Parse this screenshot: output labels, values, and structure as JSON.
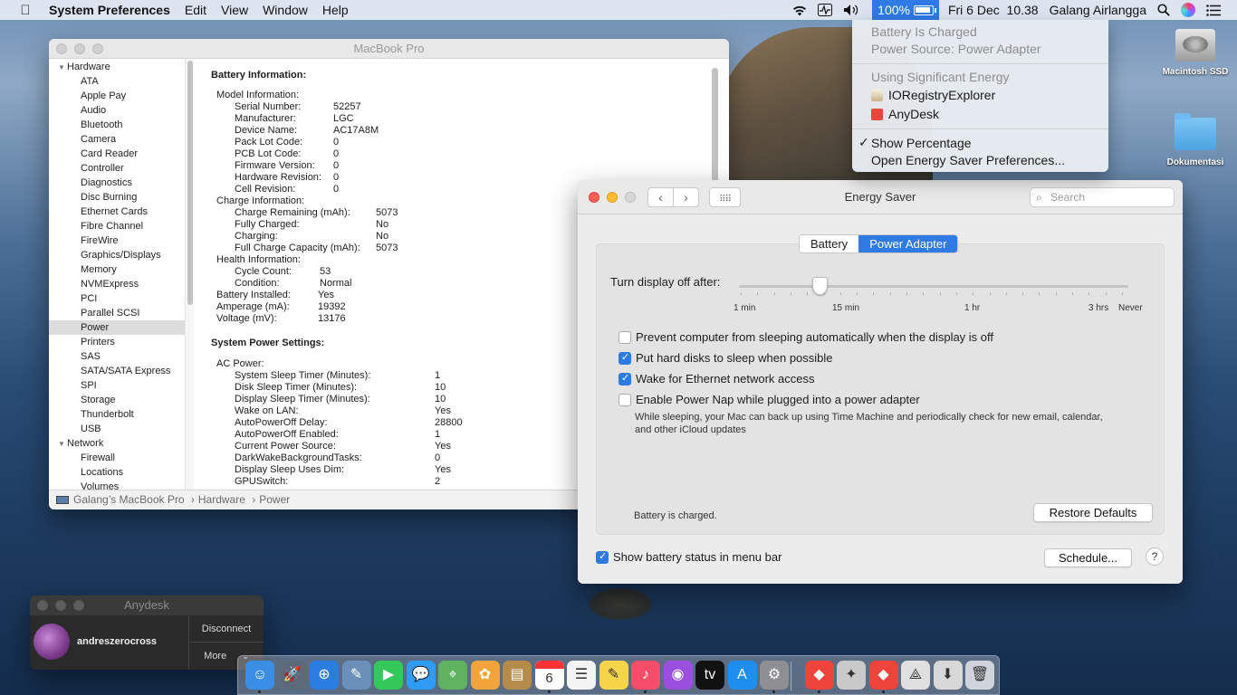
{
  "menubar": {
    "app_name": "System Preferences",
    "menus": [
      "Edit",
      "View",
      "Window",
      "Help"
    ],
    "battery_percent": "100%",
    "datetime": "Fri 6 Dec  10.38",
    "user": "Galang Airlangga"
  },
  "battery_menu": {
    "status": "Battery Is Charged",
    "source": "Power Source: Power Adapter",
    "energy_header": "Using Significant Energy",
    "apps": [
      "IORegistryExplorer",
      "AnyDesk"
    ],
    "show_percentage": "Show Percentage",
    "open_prefs": "Open Energy Saver Preferences..."
  },
  "desktop": {
    "drive_label": "Macintosh SSD",
    "folder_label": "Dokumentasi"
  },
  "sysinfo": {
    "title": "MacBook Pro",
    "sidebar": {
      "hardware_label": "Hardware",
      "hardware_items": [
        "ATA",
        "Apple Pay",
        "Audio",
        "Bluetooth",
        "Camera",
        "Card Reader",
        "Controller",
        "Diagnostics",
        "Disc Burning",
        "Ethernet Cards",
        "Fibre Channel",
        "FireWire",
        "Graphics/Displays",
        "Memory",
        "NVMExpress",
        "PCI",
        "Parallel SCSI",
        "Power",
        "Printers",
        "SAS",
        "SATA/SATA Express",
        "SPI",
        "Storage",
        "Thunderbolt",
        "USB"
      ],
      "selected": "Power",
      "network_label": "Network",
      "network_items": [
        "Firewall",
        "Locations",
        "Volumes"
      ]
    },
    "battery_heading": "Battery Information:",
    "battery_rows": [
      {
        "k": "Model Information:",
        "v": "",
        "indent": 0
      },
      {
        "k": "Serial Number:",
        "v": "52257",
        "indent": 1
      },
      {
        "k": "Manufacturer:",
        "v": "LGC",
        "indent": 1
      },
      {
        "k": "Device Name:",
        "v": "AC17A8M",
        "indent": 1
      },
      {
        "k": "Pack Lot Code:",
        "v": "0",
        "indent": 1
      },
      {
        "k": "PCB Lot Code:",
        "v": "0",
        "indent": 1
      },
      {
        "k": "Firmware Version:",
        "v": "0",
        "indent": 1
      },
      {
        "k": "Hardware Revision:",
        "v": "0",
        "indent": 1
      },
      {
        "k": "Cell Revision:",
        "v": "0",
        "indent": 1
      },
      {
        "k": "Charge Information:",
        "v": "",
        "indent": 0
      },
      {
        "k": "Charge Remaining (mAh):",
        "v": "5073",
        "indent": 2
      },
      {
        "k": "Fully Charged:",
        "v": "No",
        "indent": 2
      },
      {
        "k": "Charging:",
        "v": "No",
        "indent": 2
      },
      {
        "k": "Full Charge Capacity (mAh):",
        "v": "5073",
        "indent": 2
      },
      {
        "k": "Health Information:",
        "v": "",
        "indent": 0
      },
      {
        "k": "Cycle Count:",
        "v": "53",
        "indent": 3
      },
      {
        "k": "Condition:",
        "v": "Normal",
        "indent": 3
      },
      {
        "k": "Battery Installed:",
        "v": "Yes",
        "indent": 4
      },
      {
        "k": "Amperage (mA):",
        "v": "19392",
        "indent": 4
      },
      {
        "k": "Voltage (mV):",
        "v": "13176",
        "indent": 4
      }
    ],
    "power_heading": "System Power Settings:",
    "ac_label": "AC Power:",
    "power_rows": [
      {
        "k": "System Sleep Timer (Minutes):",
        "v": "1"
      },
      {
        "k": "Disk Sleep Timer (Minutes):",
        "v": "10"
      },
      {
        "k": "Display Sleep Timer (Minutes):",
        "v": "10"
      },
      {
        "k": "Wake on LAN:",
        "v": "Yes"
      },
      {
        "k": "AutoPowerOff Delay:",
        "v": "28800"
      },
      {
        "k": "AutoPowerOff Enabled:",
        "v": "1"
      },
      {
        "k": "Current Power Source:",
        "v": "Yes"
      },
      {
        "k": "DarkWakeBackgroundTasks:",
        "v": "0"
      },
      {
        "k": "Display Sleep Uses Dim:",
        "v": "Yes"
      },
      {
        "k": "GPUSwitch:",
        "v": "2"
      }
    ],
    "path": [
      "Galang’s MacBook Pro",
      "Hardware",
      "Power"
    ]
  },
  "energy": {
    "title": "Energy Saver",
    "search_placeholder": "Search",
    "tabs": [
      "Battery",
      "Power Adapter"
    ],
    "active_tab": "Power Adapter",
    "slider_label": "Turn display off after:",
    "slider_value": "10 min",
    "tick_labels": [
      "1 min",
      "15 min",
      "1 hr",
      "3 hrs",
      "Never"
    ],
    "options": [
      {
        "label": "Prevent computer from sleeping automatically when the display is off",
        "checked": false
      },
      {
        "label": "Put hard disks to sleep when possible",
        "checked": true
      },
      {
        "label": "Wake for Ethernet network access",
        "checked": true
      },
      {
        "label": "Enable Power Nap while plugged into a power adapter",
        "checked": false
      }
    ],
    "power_nap_desc": "While sleeping, your Mac can back up using Time Machine and periodically check for new email, calendar, and other iCloud updates",
    "status": "Battery is charged.",
    "restore": "Restore Defaults",
    "show_battery": "Show battery status in menu bar",
    "show_battery_checked": true,
    "schedule": "Schedule...",
    "help": "?"
  },
  "anydesk": {
    "title": "Anydesk",
    "user": "andreszerocross",
    "disconnect": "Disconnect",
    "more": "More"
  },
  "dock": {
    "calendar_day": "6",
    "apps": [
      "Finder",
      "Launchpad",
      "Safari",
      "Preview",
      "FaceTime",
      "Messages",
      "Maps",
      "Photos",
      "Notefile",
      "Calendar",
      "Reminders",
      "Notes",
      "Music",
      "Podcasts",
      "TV",
      "App Store",
      "System Preferences",
      "AnyDesk",
      "Directory Utility",
      "AnyDesk",
      "Network Radar",
      "Downloads",
      "Trash"
    ]
  },
  "colors": {
    "accent": "#2f7ae5",
    "menubar": "#e6ecf4"
  }
}
